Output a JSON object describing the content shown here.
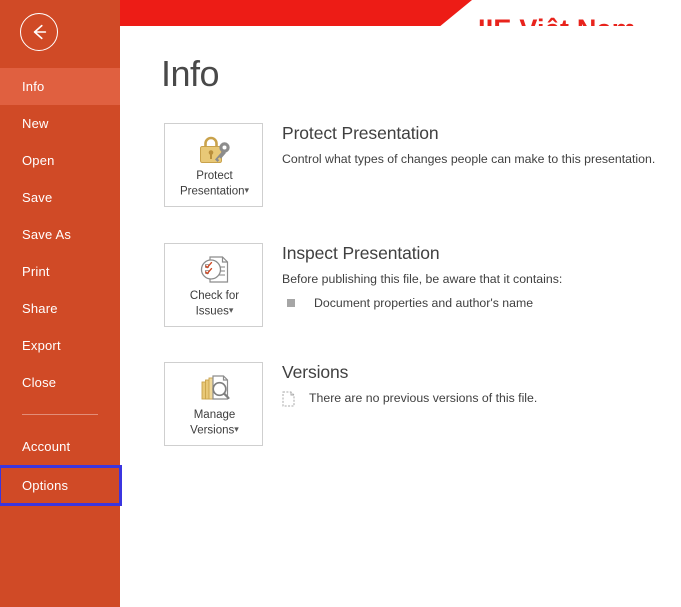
{
  "app": {
    "screen_name": "PowerPoint Backstage Info",
    "accent_orange": "#d04a26",
    "accent_orange_active": "#e06040",
    "banner_red": "#ed1c16",
    "highlight_box_color": "#3b35e0"
  },
  "banner": {
    "brand_text": "IIE Việt Nam",
    "brand_color": "#e8231c"
  },
  "sidebar": {
    "back_icon": "back-arrow-icon",
    "items": [
      {
        "label": "Info",
        "state": "active"
      },
      {
        "label": "New",
        "state": "normal"
      },
      {
        "label": "Open",
        "state": "normal"
      },
      {
        "label": "Save",
        "state": "normal"
      },
      {
        "label": "Save As",
        "state": "normal"
      },
      {
        "label": "Print",
        "state": "normal"
      },
      {
        "label": "Share",
        "state": "normal"
      },
      {
        "label": "Export",
        "state": "normal"
      },
      {
        "label": "Close",
        "state": "normal"
      },
      {
        "label": "Account",
        "state": "normal"
      },
      {
        "label": "Options",
        "state": "highlighted"
      }
    ]
  },
  "main": {
    "page_title": "Info",
    "sections": [
      {
        "button_label_line1": "Protect",
        "button_label_line2": "Presentation",
        "button_icon": "lock-and-key-icon",
        "has_caret": true,
        "heading": "Protect Presentation",
        "description": "Control what types of changes people can make to this presentation.",
        "bullets": [],
        "note": ""
      },
      {
        "button_label_line1": "Check for",
        "button_label_line2": "Issues",
        "button_icon": "document-inspect-icon",
        "has_caret": true,
        "heading": "Inspect Presentation",
        "description": "Before publishing this file, be aware that it contains:",
        "bullets": [
          "Document properties and author's name"
        ],
        "note": ""
      },
      {
        "button_label_line1": "Manage",
        "button_label_line2": "Versions",
        "button_icon": "manage-versions-icon",
        "has_caret": true,
        "heading": "Versions",
        "description": "",
        "bullets": [],
        "note": "There are no previous versions of this file."
      }
    ]
  }
}
